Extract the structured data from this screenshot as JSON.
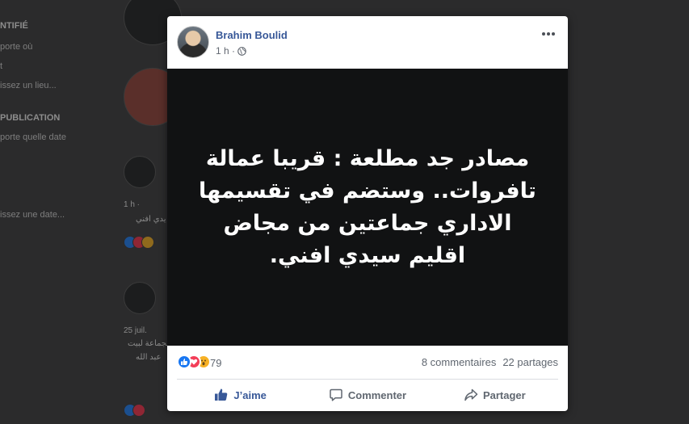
{
  "background": {
    "sidebar": {
      "section1_title": "NTIFIÉ",
      "section1_items": [
        "porte où",
        "t",
        "issez un lieu..."
      ],
      "section2_title": "PUBLICATION",
      "section2_items": [
        "porte quelle date",
        "issez une date..."
      ]
    },
    "feed": {
      "post1_meta": "1 h ·",
      "post1_text": "يدي افني",
      "post2_meta": "25 juil.",
      "post2_text_1": "بجماعة لبيت",
      "post2_text_2": "عبد الله"
    }
  },
  "post": {
    "author": "Brahim Boulid",
    "time": "1 h ·",
    "image_text": "مصادر جد مطلعة : قريبا عمالة تافروات.. وستضم في تقسيمها الاداري جماعتين من مجاض اقليم سيدي افني.",
    "reaction_count": "79",
    "comments": "8 commentaires",
    "shares": "22 partages",
    "actions": {
      "like": "J’aime",
      "comment": "Commenter",
      "share": "Partager"
    }
  },
  "colors": {
    "link_blue": "#385898",
    "like_blue": "#1877f2",
    "love_red": "#f33e58",
    "wow_yellow": "#f7b125"
  }
}
